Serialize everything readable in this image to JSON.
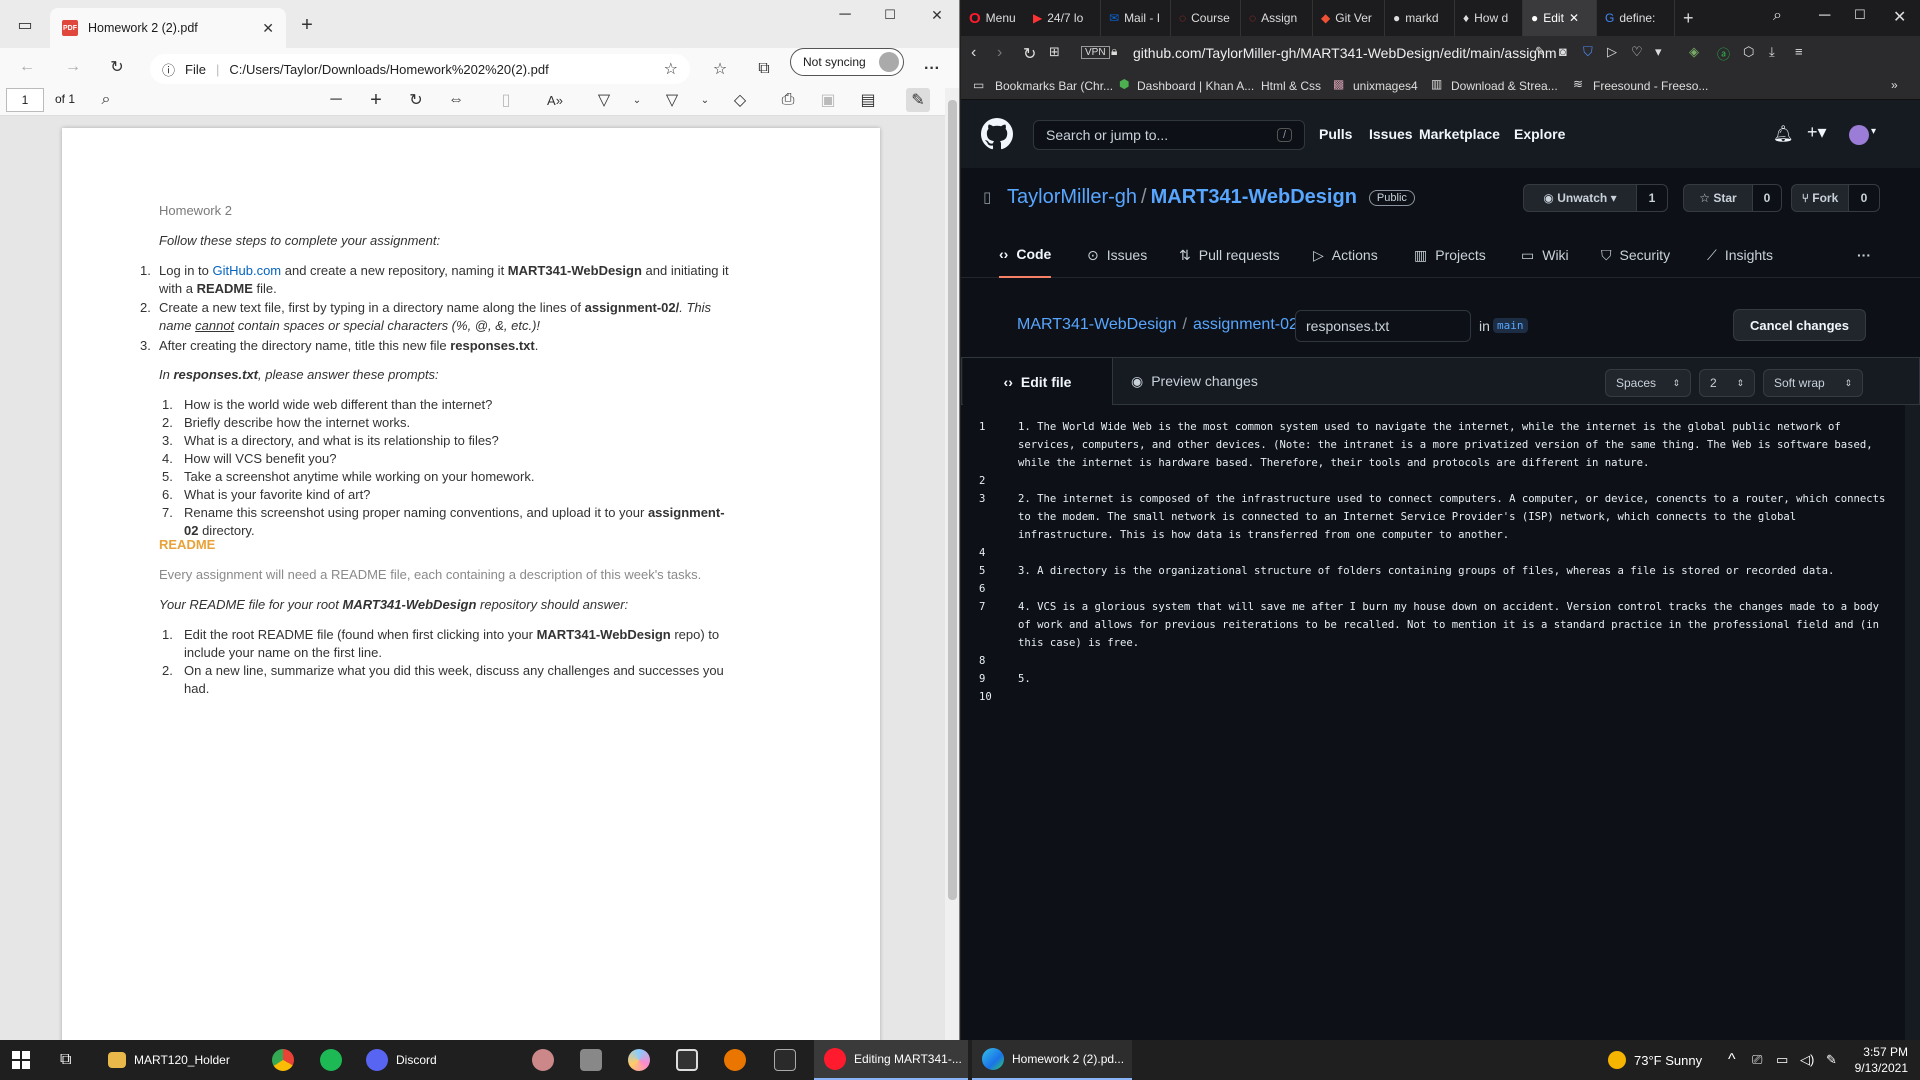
{
  "edge": {
    "tab_title": "Homework 2 (2).pdf",
    "address": "C:/Users/Taylor/Downloads/Homework%202%20(2).pdf",
    "address_prefix": "File",
    "sync_label": "Not syncing",
    "page_number": "1",
    "page_total": "of 1",
    "pdf": {
      "title": "Homework 2",
      "intro": "Follow these steps to complete your assignment:",
      "step1_a": "Log in to ",
      "step1_link": "GitHub.com",
      "step1_b": " and create a new repository, naming it ",
      "step1_repo": "MART341-WebDesign",
      "step1_c": " and initiating it",
      "step1_d": "with a ",
      "step1_readme": "README",
      "step1_e": " file.",
      "step2_a": "Create a new text file, first by typing in a directory name along the lines of ",
      "step2_dir": "assignment-02/",
      "step2_b": ". This",
      "step2_c": "name ",
      "step2_cannot": "cannot",
      "step2_d": " contain spaces or special characters (%, @, &, etc.)!",
      "step3_a": "After creating the directory name, title this new file ",
      "step3_file": "responses.txt",
      "step3_b": ".",
      "prompts_intro_a": "In ",
      "prompts_intro_file": "responses.txt",
      "prompts_intro_b": ", please answer these prompts:",
      "prompts": [
        "How is the world wide web different than the internet?",
        "Briefly describe how the internet works.",
        "What is a directory, and what is its relationship to files?",
        "How will VCS benefit you?",
        "Take a screenshot anytime while working on your homework.",
        "What is your favorite kind of art?"
      ],
      "prompt7_a": "Rename this screenshot using proper naming conventions, and upload it to your ",
      "prompt7_b": "assignment-",
      "prompt7_c": "02",
      "prompt7_d": " directory.",
      "readme_heading": "README",
      "readme_desc": "Every assignment will need a README file, each containing a description of this week's tasks.",
      "readme_intro_a": "Your README file for your root ",
      "readme_intro_repo": "MART341-WebDesign",
      "readme_intro_b": " repository should answer:",
      "readme1_a": "Edit the root README file (found when first clicking into your ",
      "readme1_repo": "MART341-WebDesign",
      "readme1_b": " repo) to",
      "readme1_c": "include your name on the first line.",
      "readme2_a": "On a new line, summarize what you did this week, discuss any challenges and successes you",
      "readme2_b": "had."
    }
  },
  "opera": {
    "menu_label": "Menu",
    "tabs": [
      "24/7 lo",
      "Mail - I",
      "Course",
      "Assign",
      "Git Ver",
      "markd",
      "How d",
      "Edit",
      "define:"
    ],
    "address": "github.com/TaylorMiller-gh/MART341-WebDesign/edit/main/assignm",
    "vpn": "VPN",
    "bookmarks": [
      "Bookmarks Bar (Chr...",
      "Dashboard | Khan A...",
      "Html & Css",
      "unixmages4",
      "Download & Strea...",
      "Freesound - Freeso..."
    ]
  },
  "github": {
    "search_placeholder": "Search or jump to...",
    "search_key": "/",
    "nav": [
      "Pulls",
      "Issues",
      "Marketplace",
      "Explore"
    ],
    "owner": "TaylorMiller-gh",
    "sep": "/",
    "repo": "MART341-WebDesign",
    "visibility": "Public",
    "unwatch": "Unwatch",
    "unwatch_count": "1",
    "star": "Star",
    "star_count": "0",
    "fork": "Fork",
    "fork_count": "0",
    "repo_tabs": [
      "Code",
      "Issues",
      "Pull requests",
      "Actions",
      "Projects",
      "Wiki",
      "Security",
      "Insights"
    ],
    "more": "···",
    "breadcrumb_repo": "MART341-WebDesign",
    "breadcrumb_dir": "assignment-02",
    "filename": "responses.txt",
    "in": "in",
    "branch": "main",
    "cancel": "Cancel changes",
    "edit_tab": "Edit file",
    "preview_tab": "Preview changes",
    "indent_mode": "Spaces",
    "indent_size": "2",
    "wrap_mode": "Soft wrap",
    "lines": [
      {
        "n": "1",
        "text": "1. The World Wide Web is the most common system used to navigate the internet, while the internet is the global public network of services, computers, and other devices. (Note: the intranet is a more privatized version of the same thing. The Web is software based, while the internet is hardware based. Therefore, their tools and protocols are different in nature."
      },
      {
        "n": "2",
        "text": ""
      },
      {
        "n": "3",
        "text": "2. The internet is composed of the infrastructure used to connect computers. A computer, or device, conencts to a router, which connects to the modem. The small network is connected to an Internet Service Provider's (ISP) network, which connects to the global infrastructure. This is how data is transferred from one computer to another."
      },
      {
        "n": "4",
        "text": ""
      },
      {
        "n": "5",
        "text": "3. A directory is the organizational structure of folders containing groups of files, whereas a file is stored or recorded data."
      },
      {
        "n": "6",
        "text": ""
      },
      {
        "n": "7",
        "text": "4. VCS is a glorious system that will save me after I burn my house down on accident. Version control tracks the changes made to a body of work and allows for previous reiterations to be recalled. Not to mention it is a standard practice in the professional field and (in this case) is free."
      },
      {
        "n": "8",
        "text": ""
      },
      {
        "n": "9",
        "text": "5."
      },
      {
        "n": "10",
        "text": ""
      }
    ]
  },
  "taskbar": {
    "items": [
      "MART120_Holder",
      "Discord",
      "Editing MART341-...",
      "Homework 2 (2).pd..."
    ],
    "weather": "73°F  Sunny",
    "time": "3:57 PM",
    "date": "9/13/2021"
  },
  "colors": {
    "accent_link": "#58a6ff",
    "readme_orange": "#e8a23a",
    "pdf_link": "#0563c1"
  }
}
